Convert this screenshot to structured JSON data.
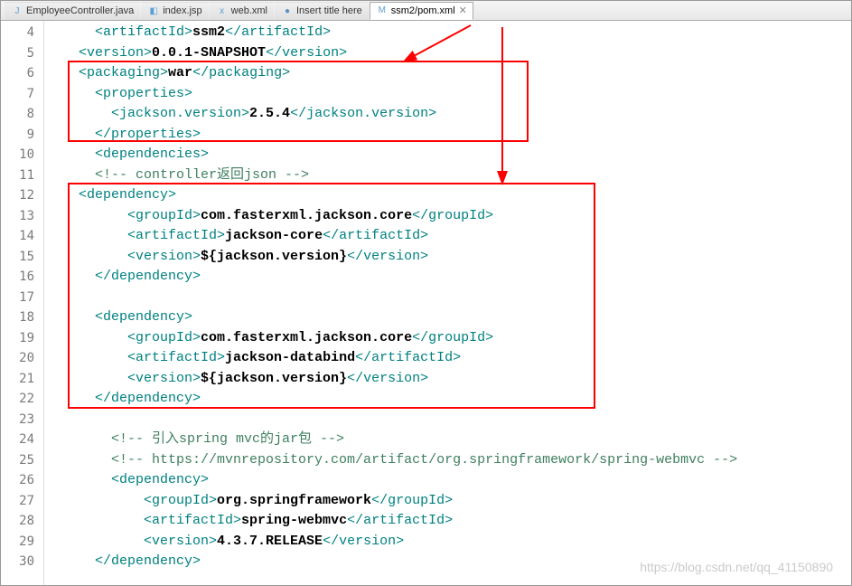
{
  "tabs": [
    {
      "label": "EmployeeController.java",
      "icon": "J"
    },
    {
      "label": "index.jsp",
      "icon": "◧"
    },
    {
      "label": "web.xml",
      "icon": "x"
    },
    {
      "label": "Insert title here",
      "icon": "●"
    },
    {
      "label": "ssm2/pom.xml",
      "icon": "M",
      "active": true
    }
  ],
  "code": {
    "l4": {
      "pre": "    ",
      "t1": "<artifactId>",
      "v": "ssm2",
      "t2": "</artifactId>"
    },
    "l5": {
      "pre": "  ",
      "t1": "<version>",
      "v": "0.0.1-SNAPSHOT",
      "t2": "</version>"
    },
    "l6": {
      "pre": "  ",
      "t1": "<packaging>",
      "v": "war",
      "t2": "</packaging>"
    },
    "l7": {
      "pre": "    ",
      "t1": "<properties>"
    },
    "l8": {
      "pre": "      ",
      "t1": "<jackson.version>",
      "v": "2.5.4",
      "t2": "</jackson.version>"
    },
    "l9": {
      "pre": "    ",
      "t1": "</properties>"
    },
    "l10": {
      "pre": "    ",
      "t1": "<dependencies>"
    },
    "l11": {
      "pre": "    ",
      "c": "<!-- controller返回json -->"
    },
    "l12": {
      "pre": "  ",
      "t1": "<dependency>"
    },
    "l13": {
      "pre": "        ",
      "t1": "<groupId>",
      "v": "com.fasterxml.jackson.core",
      "t2": "</groupId>"
    },
    "l14": {
      "pre": "        ",
      "t1": "<artifactId>",
      "v": "jackson-core",
      "t2": "</artifactId>"
    },
    "l15": {
      "pre": "        ",
      "t1": "<version>",
      "v": "${jackson.version}",
      "t2": "</version>"
    },
    "l16": {
      "pre": "    ",
      "t1": "</dependency>"
    },
    "l17": {
      "pre": ""
    },
    "l18": {
      "pre": "    ",
      "t1": "<dependency>"
    },
    "l19": {
      "pre": "        ",
      "t1": "<groupId>",
      "v": "com.fasterxml.jackson.core",
      "t2": "</groupId>"
    },
    "l20": {
      "pre": "        ",
      "t1": "<artifactId>",
      "v": "jackson-databind",
      "t2": "</artifactId>"
    },
    "l21": {
      "pre": "        ",
      "t1": "<version>",
      "v": "${jackson.version}",
      "t2": "</version>"
    },
    "l22": {
      "pre": "    ",
      "t1": "</dependency>"
    },
    "l23": {
      "pre": ""
    },
    "l24": {
      "pre": "      ",
      "c": "<!-- 引入spring mvc的jar包 -->"
    },
    "l25": {
      "pre": "      ",
      "c": "<!-- https://mvnrepository.com/artifact/org.springframework/spring-webmvc -->"
    },
    "l26": {
      "pre": "      ",
      "t1": "<dependency>"
    },
    "l27": {
      "pre": "          ",
      "t1": "<groupId>",
      "v": "org.springframework",
      "t2": "</groupId>"
    },
    "l28": {
      "pre": "          ",
      "t1": "<artifactId>",
      "v": "spring-webmvc",
      "t2": "</artifactId>"
    },
    "l29": {
      "pre": "          ",
      "t1": "<version>",
      "v": "4.3.7.RELEASE",
      "t2": "</version>"
    },
    "l30": {
      "pre": "    ",
      "t1": "</dependency>"
    }
  },
  "line_numbers": [
    "4",
    "5",
    "6",
    "7",
    "8",
    "9",
    "10",
    "11",
    "12",
    "13",
    "14",
    "15",
    "16",
    "17",
    "18",
    "19",
    "20",
    "21",
    "22",
    "23",
    "24",
    "25",
    "26",
    "27",
    "28",
    "29",
    "30"
  ],
  "watermark": "https://blog.csdn.net/qq_41150890"
}
